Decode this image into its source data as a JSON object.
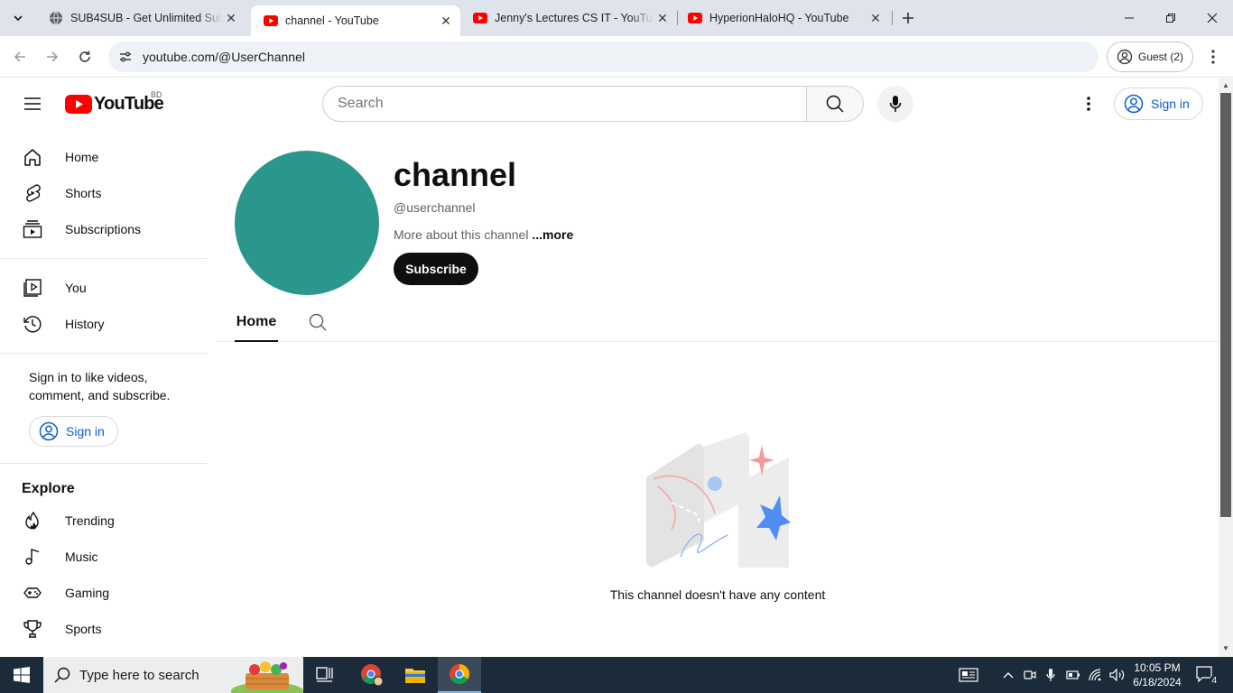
{
  "browser": {
    "tabs": [
      {
        "title": "SUB4SUB - Get Unlimited Subsc",
        "favicon": "globe-icon"
      },
      {
        "title": "channel - YouTube",
        "favicon": "youtube-icon"
      },
      {
        "title": "Jenny's Lectures CS IT - YouTub",
        "favicon": "youtube-icon"
      },
      {
        "title": "HyperionHaloHQ - YouTube",
        "favicon": "youtube-icon"
      }
    ],
    "active_tab": 1,
    "url": "youtube.com/@UserChannel",
    "profile_label": "Guest (2)"
  },
  "youtube": {
    "logo_text": "YouTube",
    "country_code": "BD",
    "search_placeholder": "Search",
    "sign_in_label": "Sign in",
    "sidebar": {
      "main": [
        {
          "label": "Home",
          "icon": "home-icon"
        },
        {
          "label": "Shorts",
          "icon": "shorts-icon"
        },
        {
          "label": "Subscriptions",
          "icon": "subscriptions-icon"
        }
      ],
      "you": [
        {
          "label": "You",
          "icon": "you-icon"
        },
        {
          "label": "History",
          "icon": "history-icon"
        }
      ],
      "signin_prompt": "Sign in to like videos, comment, and subscribe.",
      "signin_label": "Sign in",
      "explore_title": "Explore",
      "explore": [
        {
          "label": "Trending",
          "icon": "trending-icon"
        },
        {
          "label": "Music",
          "icon": "music-icon"
        },
        {
          "label": "Gaming",
          "icon": "gaming-icon"
        },
        {
          "label": "Sports",
          "icon": "sports-icon"
        }
      ]
    },
    "channel": {
      "name": "channel",
      "handle": "@userchannel",
      "about": "More about this channel",
      "more": "...more",
      "subscribe_label": "Subscribe",
      "avatar_color": "#2b968c",
      "tabs": [
        {
          "label": "Home"
        }
      ],
      "empty_message": "This channel doesn't have any content"
    }
  },
  "taskbar": {
    "search_placeholder": "Type here to search",
    "time": "10:05 PM",
    "date": "6/18/2024",
    "notification_count": "4"
  },
  "colors": {
    "accent_blue": "#065fd4",
    "youtube_red": "#ff0000",
    "taskbar": "#1c2b3a"
  }
}
